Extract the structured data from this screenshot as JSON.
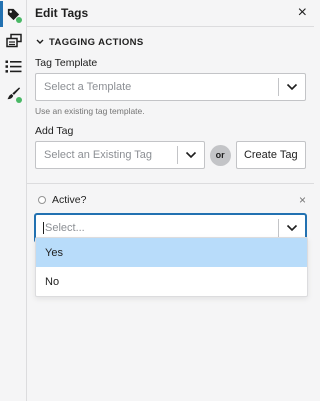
{
  "panel": {
    "title": "Edit Tags"
  },
  "section": {
    "title": "TAGGING ACTIONS"
  },
  "tag_template": {
    "label": "Tag Template",
    "placeholder": "Select a Template",
    "help": "Use an existing tag template."
  },
  "add_tag": {
    "label": "Add Tag",
    "placeholder": "Select an Existing Tag",
    "or_label": "or",
    "create_label": "Create Tag"
  },
  "active": {
    "label": "Active?",
    "placeholder": "Select...",
    "options": [
      "Yes",
      "No"
    ],
    "highlighted_option": "Yes"
  },
  "colors": {
    "accent": "#2271b1",
    "status_dot": "#4ab866",
    "highlight": "#b8dcfa"
  }
}
